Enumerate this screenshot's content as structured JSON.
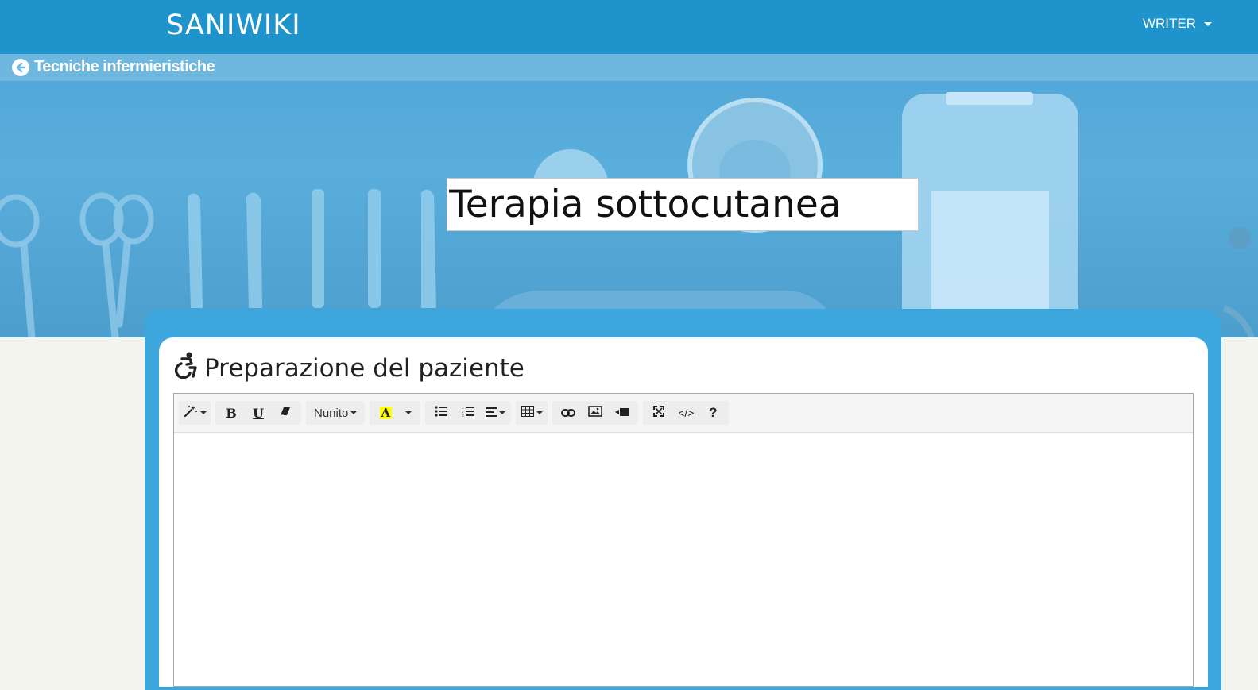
{
  "nav": {
    "brand": "SANIWIKI",
    "user_menu_label": "WRITER"
  },
  "breadcrumb": {
    "back_label": "Tecniche infermieristiche"
  },
  "page": {
    "title_value": "Terapia sottocutanea"
  },
  "section": {
    "heading": "Preparazione del paziente",
    "icon": "wheelchair-icon"
  },
  "editor": {
    "font_name": "Nunito",
    "content": "",
    "toolbar": [
      {
        "group": "style",
        "items": [
          "magic-wand-icon"
        ]
      },
      {
        "group": "font",
        "items": [
          "bold-icon",
          "underline-icon",
          "eraser-icon"
        ]
      },
      {
        "group": "fontname",
        "items": [
          "Nunito"
        ]
      },
      {
        "group": "color",
        "items": [
          "text-color-icon",
          "color-dropdown-icon"
        ]
      },
      {
        "group": "para",
        "items": [
          "bullet-list-icon",
          "numbered-list-icon",
          "align-icon"
        ]
      },
      {
        "group": "table",
        "items": [
          "table-icon"
        ]
      },
      {
        "group": "insert",
        "items": [
          "link-icon",
          "image-icon",
          "video-icon"
        ]
      },
      {
        "group": "view",
        "items": [
          "fullscreen-icon",
          "code-view-icon",
          "help-icon"
        ]
      }
    ],
    "help_label": "?",
    "code_label": "</>"
  },
  "colors": {
    "navbar": "#1e93cc",
    "card": "#3da6dc",
    "page_bg": "#f4f4ee",
    "highlight_yellow": "#ffff00"
  }
}
